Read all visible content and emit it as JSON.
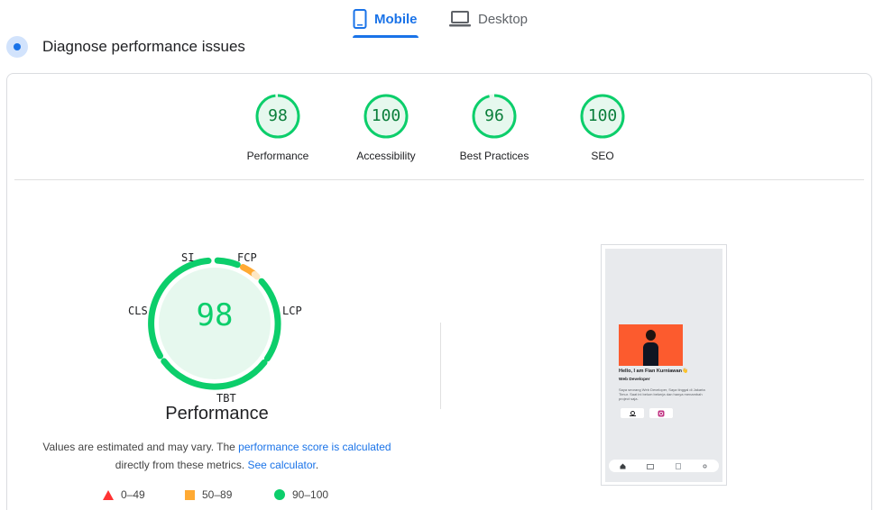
{
  "tabs": {
    "mobile": "Mobile",
    "desktop": "Desktop",
    "active": "mobile"
  },
  "heading": "Diagnose performance issues",
  "scores": [
    {
      "label": "Performance",
      "value": 98
    },
    {
      "label": "Accessibility",
      "value": 100
    },
    {
      "label": "Best Practices",
      "value": 96
    },
    {
      "label": "SEO",
      "value": 100
    }
  ],
  "main_gauge": {
    "value": 98,
    "title": "Performance",
    "metrics": [
      "SI",
      "FCP",
      "LCP",
      "TBT",
      "CLS"
    ]
  },
  "note": {
    "text1": "Values are estimated and may vary. The ",
    "link1": "performance score is calculated",
    "text2": "directly from these metrics. ",
    "link2": "See calculator",
    "text3": "."
  },
  "legend": [
    {
      "range": "0–49",
      "shape": "triangle",
      "color": "#ff3333"
    },
    {
      "range": "50–89",
      "shape": "square",
      "color": "#ffaa33"
    },
    {
      "range": "90–100",
      "shape": "circle",
      "color": "#0cce6b"
    }
  ],
  "colors": {
    "accent": "#1a73e8",
    "pass": "#0cce6b",
    "pass_text": "#0a7e3a",
    "average": "#ffaa33",
    "fail": "#ff3333"
  },
  "screenshot": {
    "title": "Hello, I am Fian Kurniawan👋",
    "subtitle": "Web Developer",
    "description": "Saya seorang Web Developer, Saya tinggal di Jakarta Timur. Saat ini belum bekerja dan hanya menambah project saja."
  }
}
